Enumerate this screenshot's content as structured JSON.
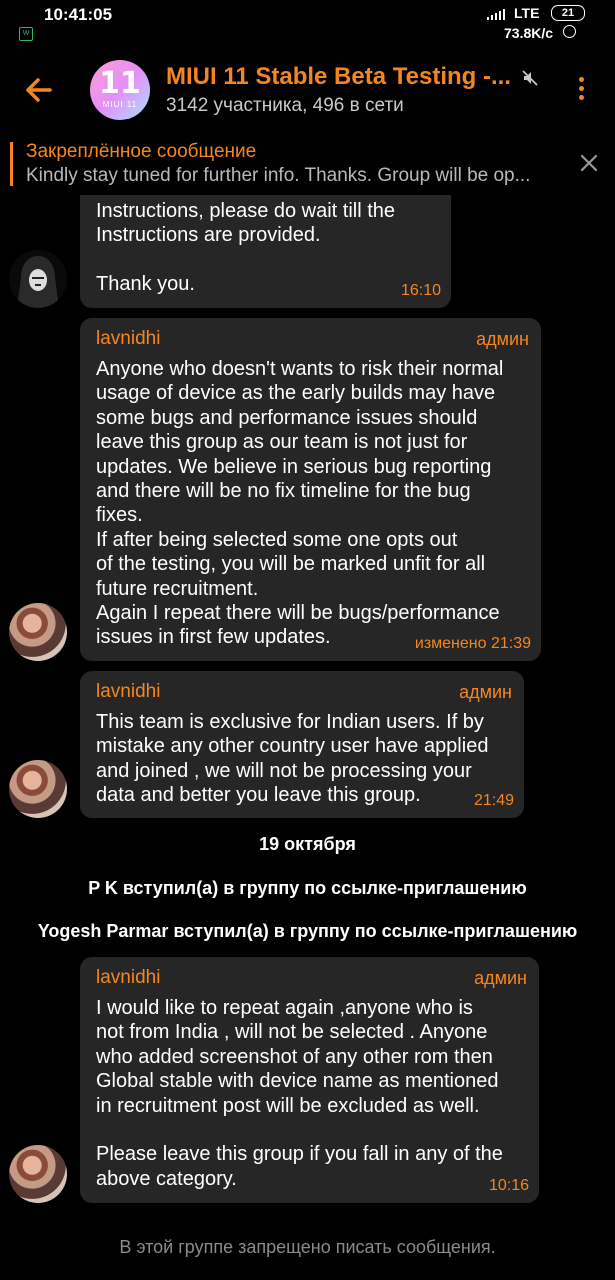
{
  "status_bar": {
    "time": "10:41:05",
    "network": "LTE",
    "battery": "21",
    "speed": "73.8K/c"
  },
  "header": {
    "title": "MIUI 11 Stable Beta Testing -...",
    "subtitle": "3142 участника, 496 в сети",
    "avatar_number": "11",
    "avatar_label": "MIUI 11",
    "accent_color": "#f48622"
  },
  "pinned": {
    "title": "Закреплённое сообщение",
    "text": "Kindly stay tuned for further info. Thanks. Group will be op..."
  },
  "messages": [
    {
      "body": "Instructions, please do wait till the\nInstructions are provided.\n\nThank you.",
      "time": "16:10"
    },
    {
      "sender": "lavnidhi",
      "role": "админ",
      "body": "Anyone who doesn't wants to risk their normal\nusage of device as the early builds may have\nsome bugs and performance issues should\nleave this group as our team is not just for\nupdates. We believe in serious bug reporting\nand there will be no fix timeline for the bug\nfixes.\nIf after being selected  some one opts out\nof the testing, you will be marked unfit for all\nfuture recruitment.\nAgain I repeat there will be bugs/performance\nissues in first few updates.",
      "time": "изменено 21:39"
    },
    {
      "sender": "lavnidhi",
      "role": "админ",
      "body": "This team is exclusive for Indian users. If by\nmistake any other country user have applied\nand joined , we will not be processing your\ndata and better you leave this group.",
      "time": "21:49"
    },
    {
      "sender": "lavnidhi",
      "role": "админ",
      "body": "I would like to repeat again ,anyone who is\nnot from India , will not be selected . Anyone\nwho added screenshot of any other rom then\nGlobal stable with device name as mentioned\nin recruitment post will be excluded as well.\n\nPlease leave this group if you fall in any of the\nabove category.",
      "time": "10:16"
    }
  ],
  "date_separator": "19 октября",
  "service_messages": [
    "P K вступил(а) в группу по ссылке-приглашению",
    "Yogesh Parmar вступил(а) в группу по ссылке-приглашению"
  ],
  "footer_note": "В этой группе запрещено писать сообщения."
}
